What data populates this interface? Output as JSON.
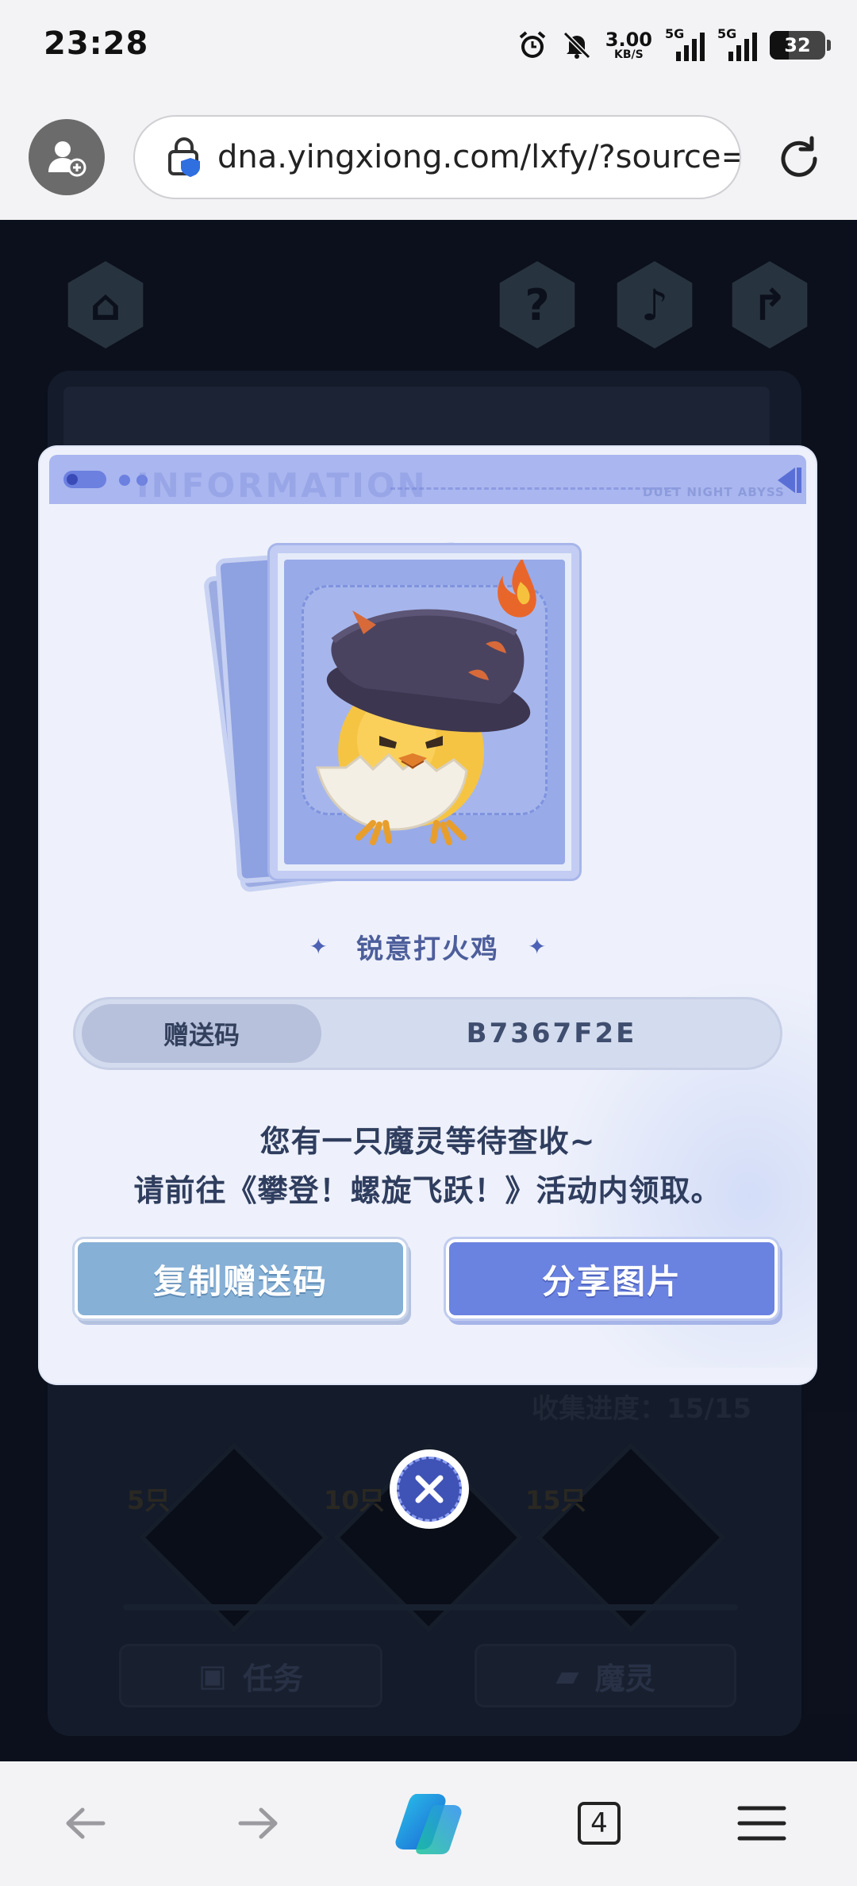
{
  "status_bar": {
    "time": "23:28",
    "net_speed_value": "3.00",
    "net_speed_unit": "KB/S",
    "sim1_label": "5G",
    "sim2_label": "5G",
    "battery": "32",
    "icons": [
      "alarm-icon",
      "mute-icon",
      "signal-icon",
      "signal-icon",
      "battery-icon"
    ]
  },
  "browser": {
    "url": "dna.yingxiong.com/lxfy/?source=t",
    "tab_count": "4",
    "icons": [
      "profile-icon",
      "secure-lock-icon",
      "reload-icon",
      "back-arrow-icon",
      "forward-arrow-icon",
      "copilot-icon",
      "menu-icon"
    ]
  },
  "background_game": {
    "progress": "收集进度：15/15",
    "milestones": [
      "5只",
      "10只",
      "15只"
    ],
    "task_button": "任务",
    "spirit_button": "魔灵",
    "top_icons": [
      "home-icon",
      "help-icon",
      "music-icon",
      "share-icon"
    ]
  },
  "modal": {
    "header_faint": "INFORMATION",
    "header_brand": "DUET NIGHT ABYSS",
    "pet_name": "锐意打火鸡",
    "code_label": "赠送码",
    "code_value": "B7367F2E",
    "message_line1": "您有一只魔灵等待查收~",
    "message_line2": "请前往《攀登！螺旋飞跃！》活动内领取。",
    "copy_button": "复制赠送码",
    "share_button": "分享图片",
    "close_icon": "close-icon",
    "colors": {
      "accent": "#6a82e0",
      "copy_button": "#86b0d6",
      "modal_bg": "#eef1fb"
    }
  }
}
